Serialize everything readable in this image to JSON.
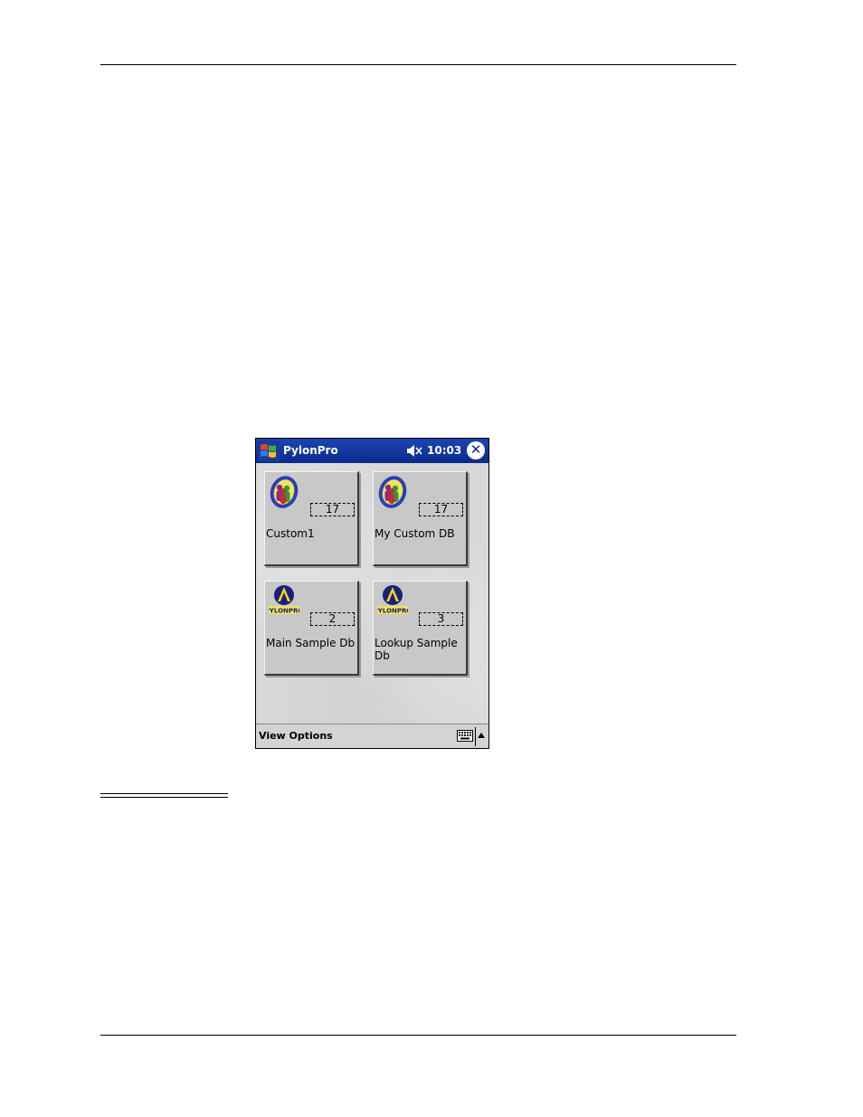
{
  "titlebar": {
    "app_title": "PylonPro",
    "time": "10:03",
    "close_glyph": "✕"
  },
  "tiles": [
    {
      "label": "Custom1",
      "count": "17",
      "icon": "people-icon"
    },
    {
      "label": "My Custom DB",
      "count": "17",
      "icon": "people-icon"
    },
    {
      "label": "Main Sample Db",
      "count": "2",
      "icon": "pylonpro-logo-icon",
      "logo_text": "PYLONPRO"
    },
    {
      "label": "Lookup Sample Db",
      "count": "3",
      "icon": "pylonpro-logo-icon",
      "logo_text": "PYLONPRO"
    }
  ],
  "menubar": {
    "view_options_label": "View Options",
    "keyboard_icon": "keyboard-icon",
    "sip_arrow_icon": "arrow-up-icon"
  },
  "colors": {
    "titlebar": "#0a2a8c",
    "workspace": "#d8d8d8",
    "tile": "#c8c8c8"
  }
}
